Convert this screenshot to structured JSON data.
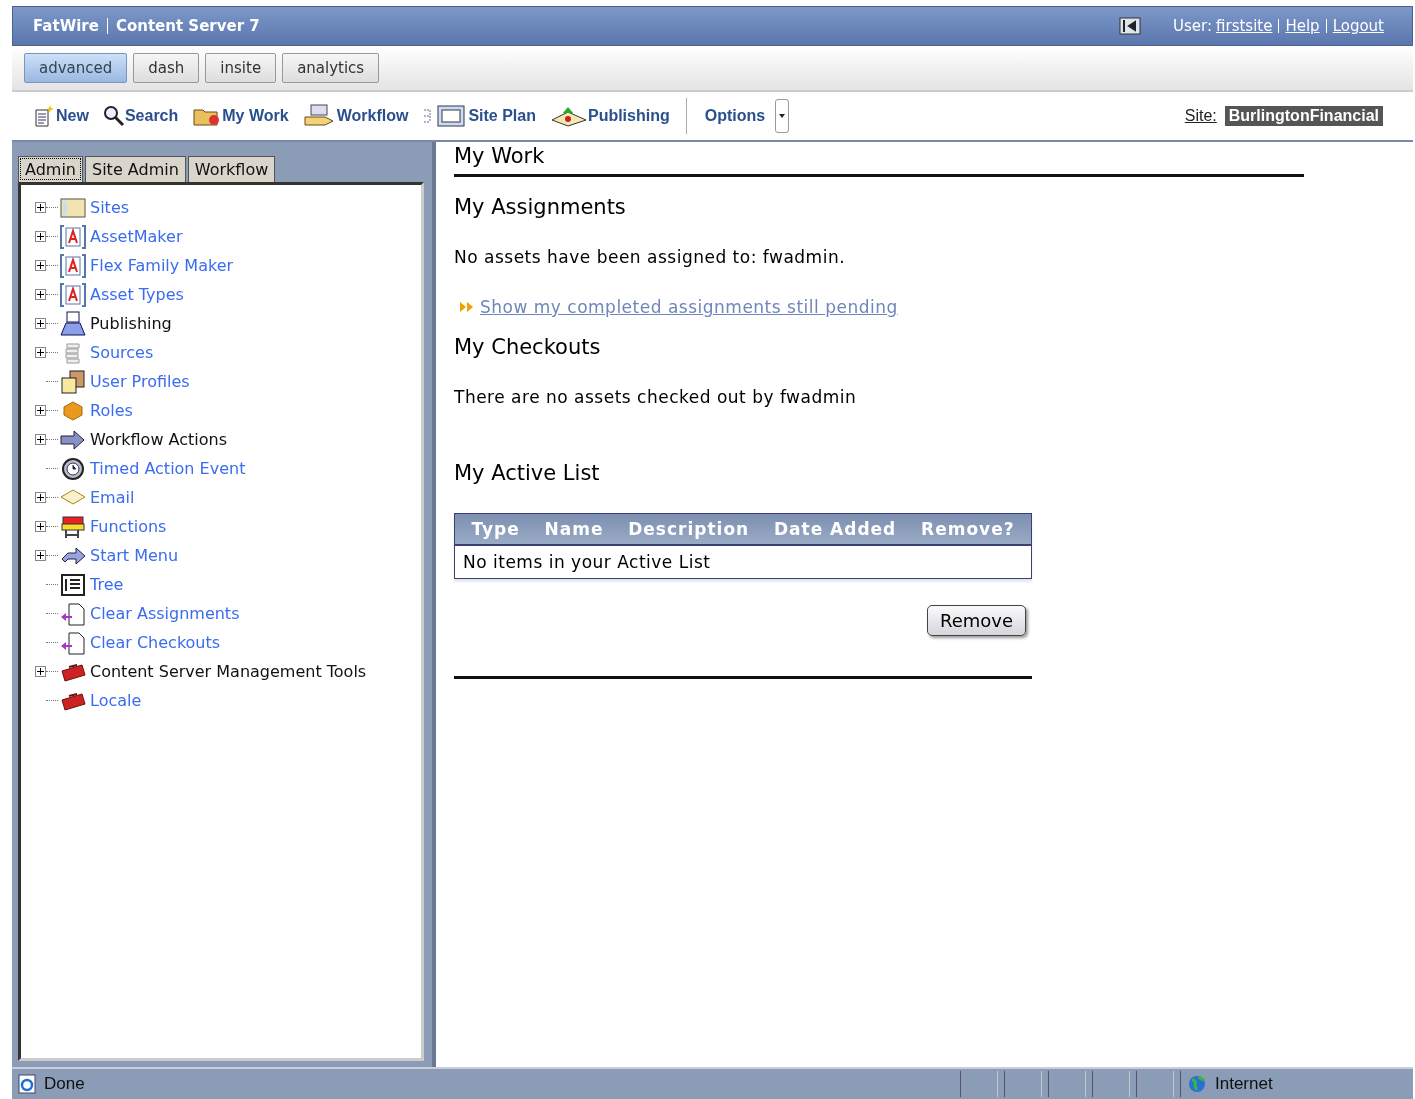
{
  "header": {
    "brand": "FatWire",
    "product": "Content Server 7",
    "user_label": "User:",
    "user": "firstsite",
    "links": [
      "Help",
      "Logout"
    ]
  },
  "app_tabs": [
    {
      "label": "advanced",
      "selected": true
    },
    {
      "label": "dash",
      "selected": false
    },
    {
      "label": "insite",
      "selected": false
    },
    {
      "label": "analytics",
      "selected": false
    }
  ],
  "toolbar": {
    "items": [
      {
        "label": "New",
        "kind": "new"
      },
      {
        "label": "Search",
        "kind": "search"
      },
      {
        "label": "My Work",
        "kind": "folder"
      },
      {
        "label": "Workflow",
        "kind": "workflow"
      },
      {
        "label": "Site Plan",
        "kind": "siteplan"
      },
      {
        "label": "Publishing",
        "kind": "publishing"
      }
    ],
    "options": "Options",
    "site_label": "Site:",
    "site": "BurlingtonFinancial"
  },
  "sidebar": {
    "tabs": [
      {
        "label": "Admin",
        "selected": true
      },
      {
        "label": "Site Admin",
        "selected": false
      },
      {
        "label": "Workflow",
        "selected": false
      }
    ],
    "tree": [
      {
        "label": "Sites",
        "kind": "sites",
        "expandable": true,
        "link": true
      },
      {
        "label": "AssetMaker",
        "kind": "asset",
        "expandable": true,
        "link": true
      },
      {
        "label": "Flex Family Maker",
        "kind": "asset",
        "expandable": true,
        "link": true
      },
      {
        "label": "Asset Types",
        "kind": "asset",
        "expandable": true,
        "link": true
      },
      {
        "label": "Publishing",
        "kind": "publishing",
        "expandable": true,
        "link": false
      },
      {
        "label": "Sources",
        "kind": "sources",
        "expandable": true,
        "link": true
      },
      {
        "label": "User Profiles",
        "kind": "users",
        "expandable": false,
        "link": true
      },
      {
        "label": "Roles",
        "kind": "roles",
        "expandable": true,
        "link": true
      },
      {
        "label": "Workflow Actions",
        "kind": "arrow",
        "expandable": true,
        "link": false
      },
      {
        "label": "Timed Action Event",
        "kind": "clock",
        "expandable": false,
        "link": true
      },
      {
        "label": "Email",
        "kind": "email",
        "expandable": true,
        "link": true
      },
      {
        "label": "Functions",
        "kind": "functions",
        "expandable": true,
        "link": true
      },
      {
        "label": "Start Menu",
        "kind": "startmenu",
        "expandable": true,
        "link": true
      },
      {
        "label": "Tree",
        "kind": "tree",
        "expandable": false,
        "link": true
      },
      {
        "label": "Clear Assignments",
        "kind": "clear",
        "expandable": false,
        "link": true
      },
      {
        "label": "Clear Checkouts",
        "kind": "clear",
        "expandable": false,
        "link": true
      },
      {
        "label": "Content Server Management Tools",
        "kind": "toolbox",
        "expandable": true,
        "link": false
      },
      {
        "label": "Locale",
        "kind": "toolbox",
        "expandable": false,
        "link": true
      }
    ]
  },
  "content": {
    "title": "My Work",
    "assignments": {
      "heading": "My Assignments",
      "message": "No assets have been assigned to: fwadmin.",
      "link": "Show my completed assignments still pending"
    },
    "checkouts": {
      "heading": "My Checkouts",
      "message": "There are no assets checked out by fwadmin"
    },
    "active_list": {
      "heading": "My Active List",
      "columns": [
        "Type",
        "Name",
        "Description",
        "Date Added",
        "Remove?"
      ],
      "empty": "No items in your Active List",
      "button": "Remove"
    }
  },
  "status_bar": {
    "text": "Done",
    "zone": "Internet"
  }
}
